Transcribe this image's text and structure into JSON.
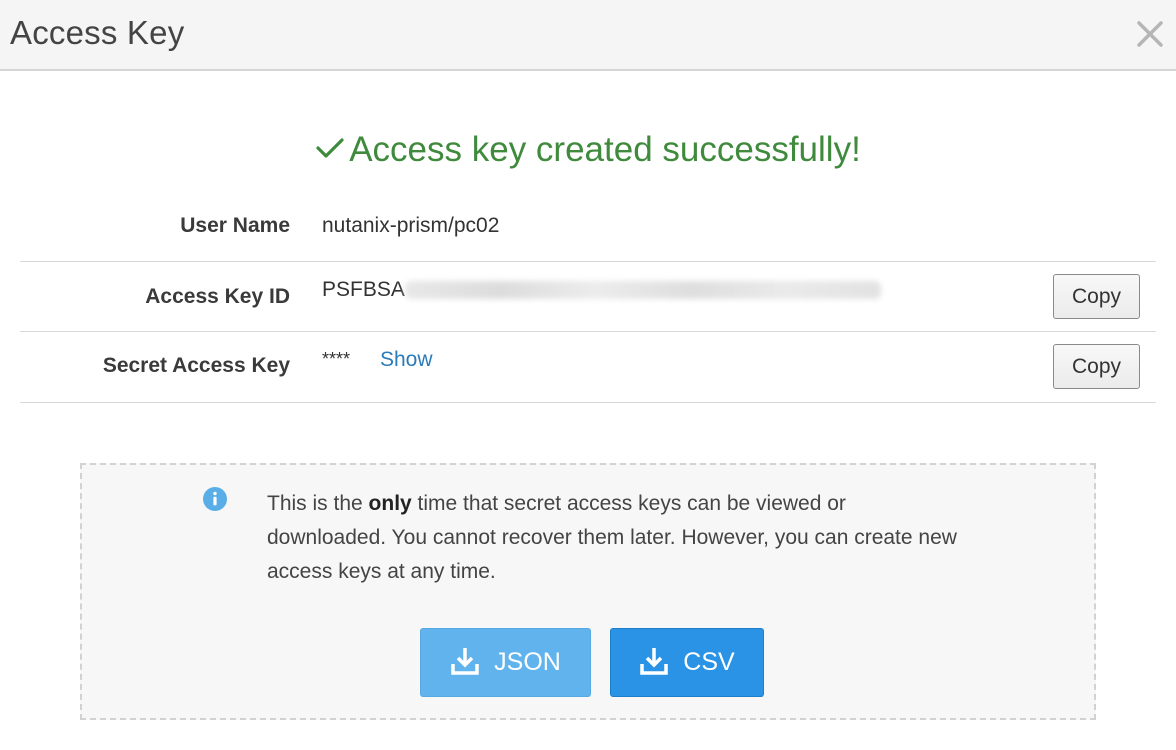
{
  "dialog": {
    "title": "Access Key",
    "close_icon": "close-icon"
  },
  "success": {
    "message": "Access key created successfully!",
    "icon": "checkmark-icon",
    "color": "#3f8a3c"
  },
  "fields": {
    "user_name": {
      "label": "User Name",
      "value": "nutanix-prism/pc02"
    },
    "access_key_id": {
      "label": "Access Key ID",
      "value_prefix": "PSFBSA",
      "copy_label": "Copy"
    },
    "secret_access_key": {
      "label": "Secret Access Key",
      "masked_value": "****",
      "show_label": "Show",
      "copy_label": "Copy"
    }
  },
  "notice": {
    "icon": "info-icon",
    "text_before": "This is the ",
    "text_bold": "only",
    "text_after": " time that secret access keys can be viewed or downloaded. You cannot recover them later. However, you can create new access keys at any time."
  },
  "downloads": {
    "json_label": "JSON",
    "csv_label": "CSV",
    "icon": "download-icon",
    "json_color": "#60b3ec",
    "csv_color": "#2a93e6"
  },
  "colors": {
    "link": "#2b7bb9",
    "header_bg": "#f5f5f5"
  }
}
